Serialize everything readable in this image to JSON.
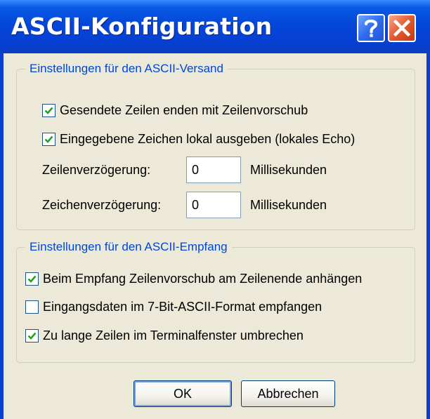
{
  "window": {
    "title": "ASCII-Konfiguration",
    "help_icon": "question-mark-icon",
    "close_icon": "close-x-icon"
  },
  "send_group": {
    "legend": "Einstellungen für den ASCII-Versand",
    "options": [
      {
        "label": "Gesendete Zeilen enden mit Zeilenvorschub",
        "checked": true
      },
      {
        "label": "Eingegebene Zeichen lokal ausgeben (lokales Echo)",
        "checked": true
      }
    ],
    "line_delay": {
      "label": "Zeilenverzögerung:",
      "value": "0",
      "unit": "Millisekunden"
    },
    "char_delay": {
      "label": "Zeichenverzögerung:",
      "value": "0",
      "unit": "Millisekunden"
    }
  },
  "receive_group": {
    "legend": "Einstellungen für den ASCII-Empfang",
    "options": [
      {
        "label": "Beim Empfang Zeilenvorschub am Zeilenende anhängen",
        "checked": true
      },
      {
        "label": "Eingangsdaten im 7-Bit-ASCII-Format empfangen",
        "checked": false
      },
      {
        "label": "Zu lange Zeilen im Terminalfenster umbrechen",
        "checked": true
      }
    ]
  },
  "buttons": {
    "ok": "OK",
    "cancel": "Abbrechen"
  },
  "colors": {
    "titlebar": "#0347d8",
    "dialog_bg": "#ece9d8",
    "legend_text": "#0046d5",
    "checkmark": "#21a121",
    "close_button": "#e35a2e"
  }
}
